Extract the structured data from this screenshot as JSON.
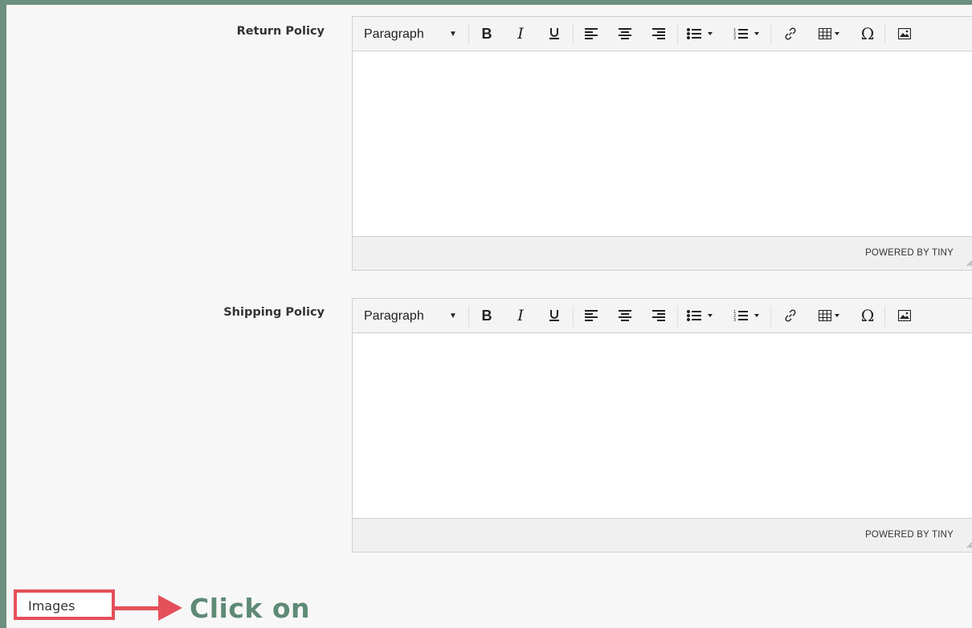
{
  "fields": [
    {
      "label": "Return Policy",
      "format_select": "Paragraph",
      "footer_text": "POWERED BY TINY"
    },
    {
      "label": "Shipping Policy",
      "format_select": "Paragraph",
      "footer_text": "POWERED BY TINY"
    }
  ],
  "toolbar_icons": [
    "bold-icon",
    "italic-icon",
    "underline-icon",
    "align-left-icon",
    "align-center-icon",
    "align-right-icon",
    "bullet-list-icon",
    "numbered-list-icon",
    "link-icon",
    "table-icon",
    "special-character-icon",
    "image-icon"
  ],
  "images_tab": {
    "label": "Images"
  },
  "annotation": {
    "text": "Click on"
  },
  "colors": {
    "frame": "#6c9080",
    "highlight": "#e4505a",
    "annotation_text": "#5e8a76"
  }
}
